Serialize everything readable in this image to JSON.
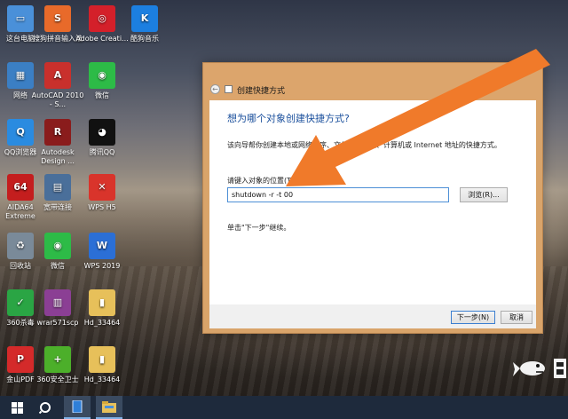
{
  "desktop": {
    "icons": [
      {
        "label": "这台电脑",
        "icon": "this-pc-icon",
        "color": "#4a90d9",
        "glyph": "▭"
      },
      {
        "label": "搜狗拼音输入法",
        "icon": "sogou-input-icon",
        "color": "#e86a2a",
        "glyph": "S"
      },
      {
        "label": "Adobe Creati...",
        "icon": "adobe-creative-cloud-icon",
        "color": "#d4202a",
        "glyph": "◎"
      },
      {
        "label": "酷狗音乐",
        "icon": "kugou-music-icon",
        "color": "#1c7fe0",
        "glyph": "K"
      },
      {
        "label": "网络",
        "icon": "network-icon",
        "color": "#3b7fc4",
        "glyph": "▦"
      },
      {
        "label": "AutoCAD 2010 - S...",
        "icon": "autocad-icon",
        "color": "#c9302c",
        "glyph": "A"
      },
      {
        "label": "微信",
        "icon": "wechat-icon",
        "color": "#2dbb47",
        "glyph": "◉"
      },
      {
        "label": "QQ浏览器",
        "icon": "qq-browser-icon",
        "color": "#2a8be0",
        "glyph": "Q"
      },
      {
        "label": "Autodesk Design ...",
        "icon": "autodesk-design-review-icon",
        "color": "#8a1c1c",
        "glyph": "R"
      },
      {
        "label": "腾讯QQ",
        "icon": "tencent-qq-icon",
        "color": "#111111",
        "glyph": "◕"
      },
      {
        "label": "AIDA64 Extreme",
        "icon": "aida64-icon",
        "color": "#c41e1e",
        "glyph": "64"
      },
      {
        "label": "宽带连接",
        "icon": "broadband-icon",
        "color": "#4a6f9a",
        "glyph": "▤"
      },
      {
        "label": "WPS H5",
        "icon": "wps-h5-icon",
        "color": "#d9342b",
        "glyph": "✕"
      },
      {
        "label": "回收站",
        "icon": "recycle-bin-icon",
        "color": "#7a8a99",
        "glyph": "♻"
      },
      {
        "label": "微信",
        "icon": "wechat-icon",
        "color": "#2dbb47",
        "glyph": "◉"
      },
      {
        "label": "WPS 2019",
        "icon": "wps-2019-icon",
        "color": "#2b6fd6",
        "glyph": "W"
      },
      {
        "label": "360杀毒",
        "icon": "360-antivirus-icon",
        "color": "#2aa544",
        "glyph": "✓"
      },
      {
        "label": "wrar571scp",
        "icon": "winrar-icon",
        "color": "#8b3f94",
        "glyph": "▥"
      },
      {
        "label": "Hd_33464",
        "icon": "folder-icon",
        "color": "#e7c05a",
        "glyph": "▮"
      },
      {
        "label": "金山PDF",
        "icon": "kingsoft-pdf-icon",
        "color": "#d42a2a",
        "glyph": "P"
      },
      {
        "label": "360安全卫士",
        "icon": "360-security-icon",
        "color": "#4caf2a",
        "glyph": "+"
      },
      {
        "label": "Hd_33464",
        "icon": "folder-icon",
        "color": "#e7c05a",
        "glyph": "▮"
      }
    ]
  },
  "dialog": {
    "title": "创建快捷方式",
    "heading": "想为哪个对象创建快捷方式?",
    "description": "该向导帮你创建本地或网络程序、文件、文件夹、计算机或 Internet 地址的快捷方式。",
    "location_label": "请键入对象的位置(T):",
    "location_value": "shutdown -r -t 00",
    "browse_label": "浏览(R)...",
    "hint": "单击\"下一步\"继续。",
    "next_label": "下一步(N)",
    "cancel_label": "取消"
  },
  "annotation": {
    "arrow_color": "#f07a2a"
  },
  "taskbar": {
    "items": [
      "start-icon",
      "search-icon",
      "task-view-icon",
      "file-explorer-icon"
    ]
  }
}
